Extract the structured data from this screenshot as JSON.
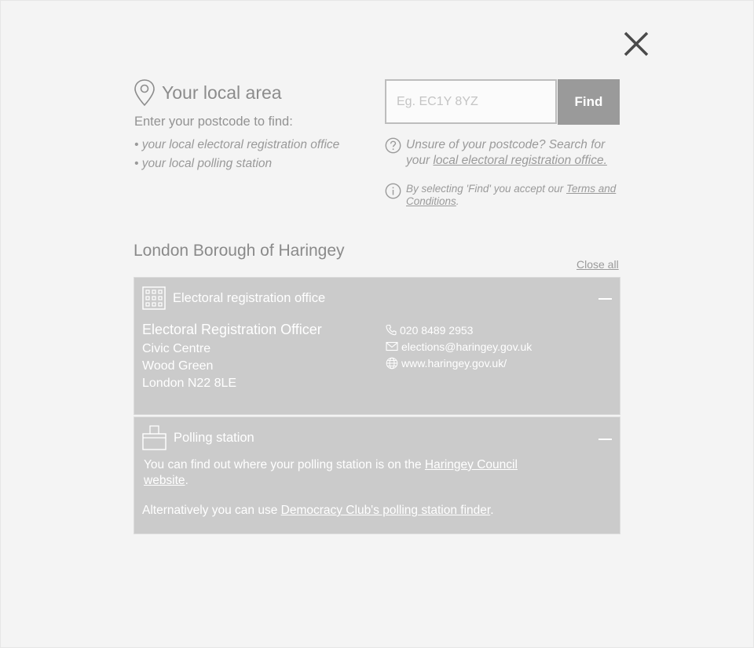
{
  "header": {
    "title": "Your local area",
    "intro": "Enter your postcode to find:",
    "bullets": [
      "• your local electoral registration office",
      "• your local polling station"
    ]
  },
  "search": {
    "placeholder": "Eg. EC1Y 8YZ",
    "value": "",
    "button_label": "Find"
  },
  "help": {
    "unsure_prefix": "Unsure of your postcode? Search for your ",
    "unsure_link": "local electoral registration office.",
    "terms_prefix": "By selecting 'Find' you accept our ",
    "terms_link": "Terms and Conditions",
    "terms_suffix": "."
  },
  "council": {
    "name": "London Borough of Haringey",
    "close_all": "Close all"
  },
  "registration_panel": {
    "title": "Electoral registration office",
    "officer_name": "Electoral Registration Officer",
    "address": [
      "Civic Centre",
      "Wood Green",
      "London N22 8LE"
    ],
    "phone": "020 8489 2953",
    "email": "elections@haringey.gov.uk",
    "website": "www.haringey.gov.uk/"
  },
  "polling_panel": {
    "title": "Polling station",
    "text_prefix": "You can find out where your polling station is on the ",
    "text_link": "Haringey Council website",
    "text_suffix": ".",
    "alt_prefix": "Alternatively you can use ",
    "alt_link": "Democracy Club's polling station finder",
    "alt_suffix": "."
  },
  "colors": {
    "background": "#f4f4f4",
    "panel": "#cbcbcb",
    "button": "#9a9a9a",
    "text": "#8a8a8a"
  },
  "icons": [
    "close-icon",
    "map-pin-icon",
    "question-icon",
    "info-icon",
    "building-icon",
    "phone-icon",
    "mail-icon",
    "globe-icon",
    "ballot-box-icon",
    "collapse-icon"
  ]
}
